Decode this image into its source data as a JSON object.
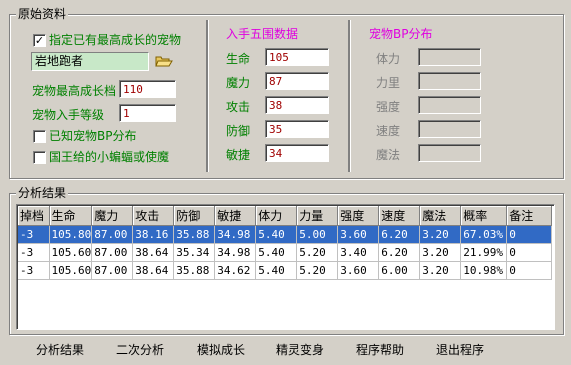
{
  "original_group": {
    "title": "原始资料",
    "specify_checkbox": {
      "checked": true,
      "label": "指定已有最高成长的宠物"
    },
    "pet_combo_value": "岩地跑者",
    "max_growth_label": "宠物最高成长档",
    "max_growth_value": "110",
    "level_label": "宠物入手等级",
    "level_value": "1",
    "known_bp_label": "已知宠物BP分布",
    "king_label": "国王给的小蝙蝠或使魔"
  },
  "stats_panel": {
    "title": "入手五围数据",
    "rows": [
      {
        "label": "生命",
        "value": "105"
      },
      {
        "label": "魔力",
        "value": "87"
      },
      {
        "label": "攻击",
        "value": "38"
      },
      {
        "label": "防御",
        "value": "35"
      },
      {
        "label": "敏捷",
        "value": "34"
      }
    ]
  },
  "bp_panel": {
    "title": "宠物BP分布",
    "rows": [
      {
        "label": "体力",
        "value": ""
      },
      {
        "label": "力里",
        "value": ""
      },
      {
        "label": "强度",
        "value": ""
      },
      {
        "label": "速度",
        "value": ""
      },
      {
        "label": "魔法",
        "value": ""
      }
    ]
  },
  "result_group": {
    "title": "分析结果",
    "columns": [
      "掉档",
      "生命",
      "魔力",
      "攻击",
      "防御",
      "敏捷",
      "体力",
      "力量",
      "强度",
      "速度",
      "魔法",
      "概率",
      "备注"
    ],
    "rows": [
      [
        "-3",
        "105.80",
        "87.00",
        "38.16",
        "35.88",
        "34.98",
        "5.40",
        "5.00",
        "3.60",
        "6.20",
        "3.20",
        "67.03%",
        "0"
      ],
      [
        "-3",
        "105.60",
        "87.00",
        "38.64",
        "35.34",
        "34.98",
        "5.40",
        "5.20",
        "3.40",
        "6.20",
        "3.20",
        "21.99%",
        "0"
      ],
      [
        "-3",
        "105.60",
        "87.00",
        "38.64",
        "35.88",
        "34.62",
        "5.40",
        "5.20",
        "3.60",
        "6.00",
        "3.20",
        "10.98%",
        "0"
      ]
    ]
  },
  "bottom_buttons": {
    "analyze": "分析结果",
    "secondary": "二次分析",
    "simulate": "模拟成长",
    "transform": "精灵变身",
    "help": "程序帮助",
    "exit": "退出程序"
  }
}
